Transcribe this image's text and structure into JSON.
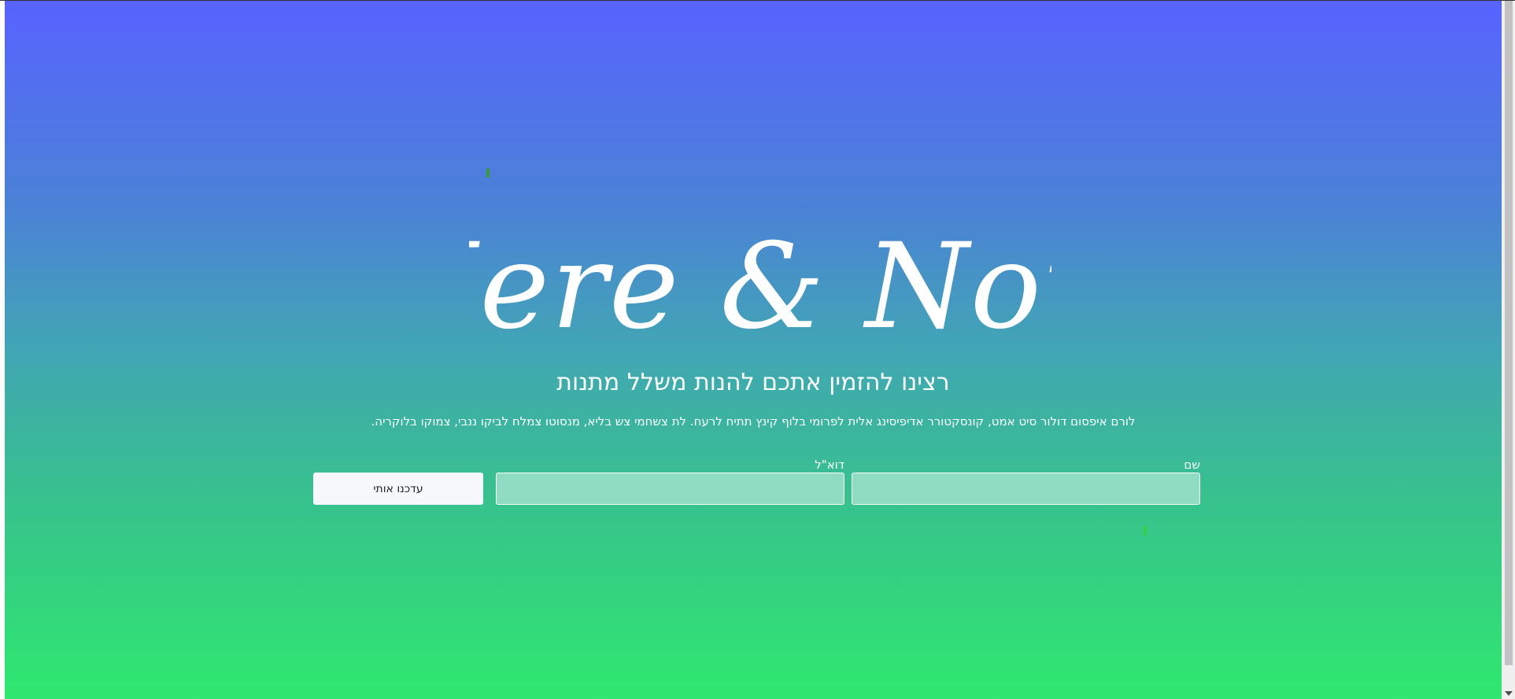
{
  "hero": {
    "logo_text": "Here & Now",
    "subtitle": "רצינו להזמין אתכם להנות משלל מתנות",
    "description": "לורם איפסום דולור סיט אמט, קונסקטורר אדיפיסינג אלית לפרומי בלוף קינץ תתיח לרעח. לת צשחמי צש בליא, מנסוטו צמלח לביקו ננבי, צמוקו בלוקריה.",
    "gradient_top": "#5763ff",
    "gradient_bottom": "#2fe86f"
  },
  "form": {
    "name_label": "שם",
    "name_value": "",
    "email_label": "דוא\"ל",
    "email_value": "",
    "submit_label": "עדכנו אותי",
    "field_bg": "#8fdcc2"
  }
}
